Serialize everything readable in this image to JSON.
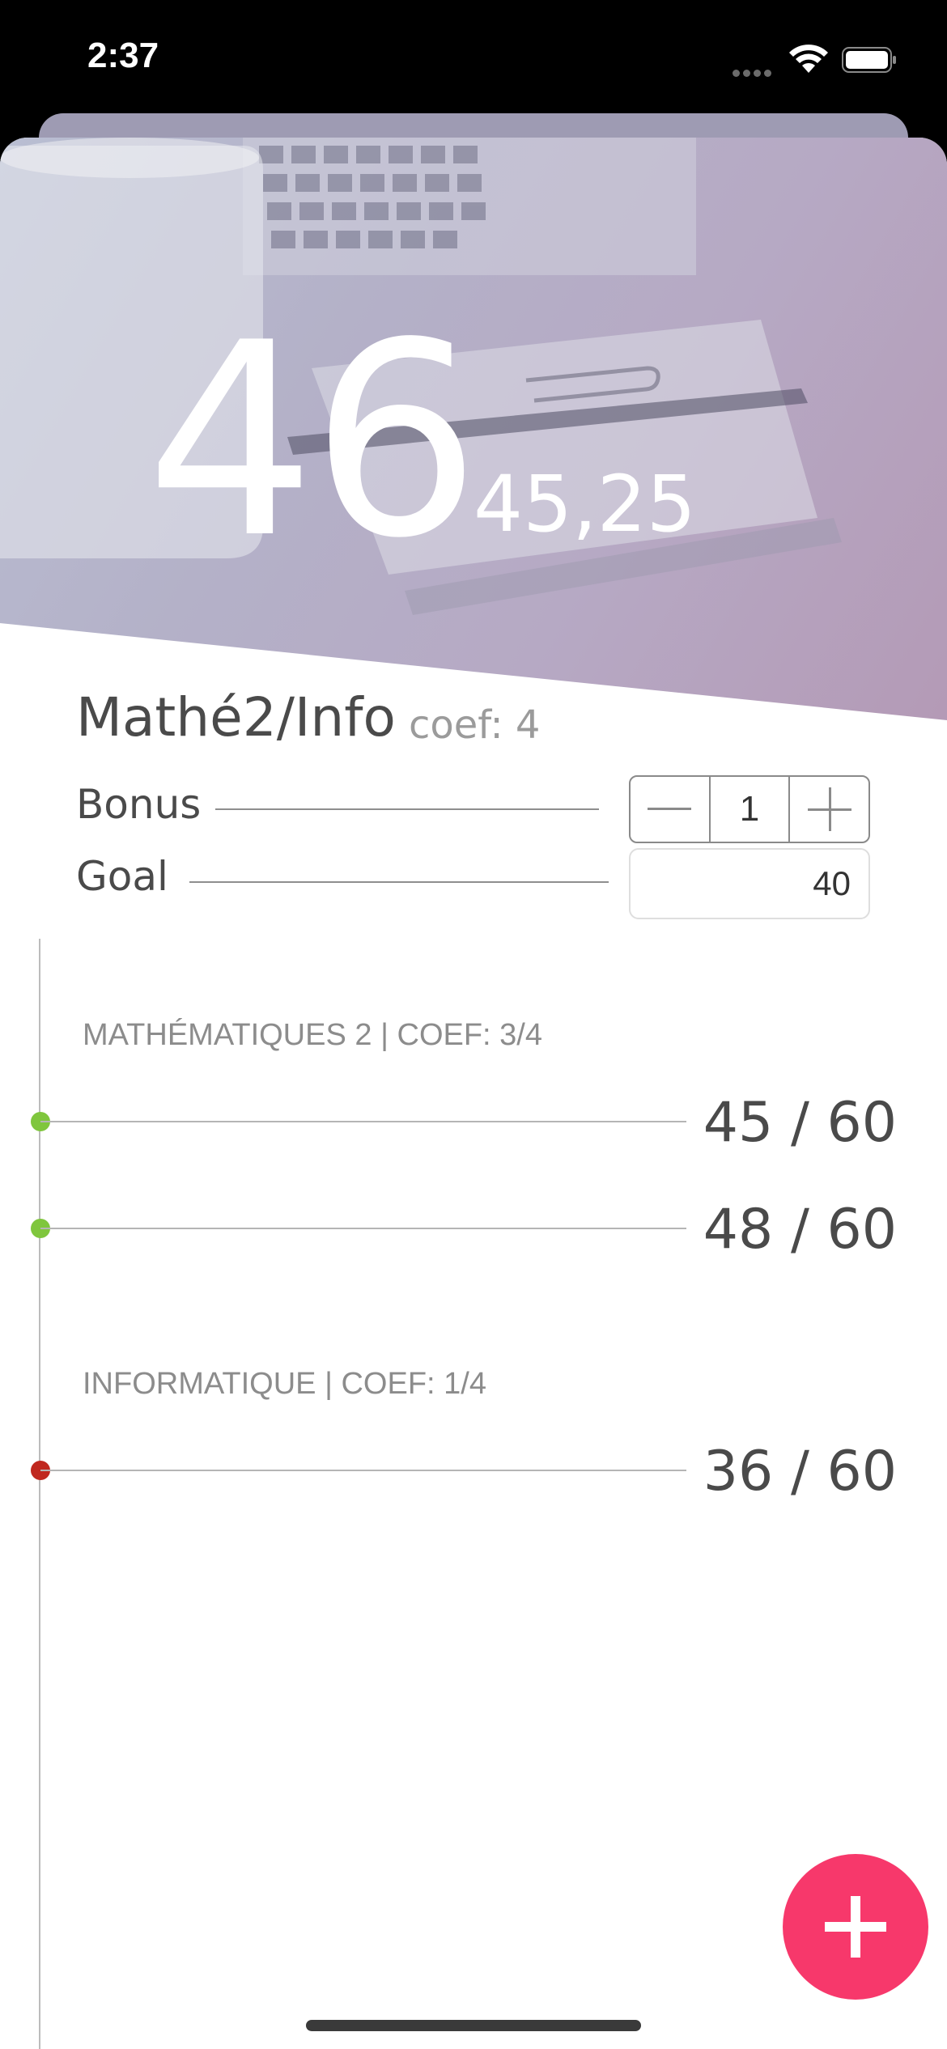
{
  "status_bar": {
    "time": "2:37"
  },
  "header": {
    "grade_rounded": "46",
    "grade_exact": "45,25"
  },
  "subject": {
    "name": "Mathé2/Info",
    "coef_label": "coef: 4"
  },
  "bonus": {
    "label": "Bonus",
    "decrement_symbol": "—",
    "value": "1",
    "increment_symbol": "+"
  },
  "goal": {
    "label": "Goal",
    "value": "40"
  },
  "sections": [
    {
      "title": "MATHÉMATIQUES 2 | COEF: 3/4",
      "grades": [
        {
          "value": "45 / 60",
          "status_color": "#7fc63d"
        },
        {
          "value": "48 / 60",
          "status_color": "#7fc63d"
        }
      ]
    },
    {
      "title": "INFORMATIQUE | COEF: 1/4",
      "grades": [
        {
          "value": "36 / 60",
          "status_color": "#c0281f"
        }
      ]
    }
  ],
  "fab": {
    "icon": "plus-icon",
    "color": "#f7386b"
  }
}
